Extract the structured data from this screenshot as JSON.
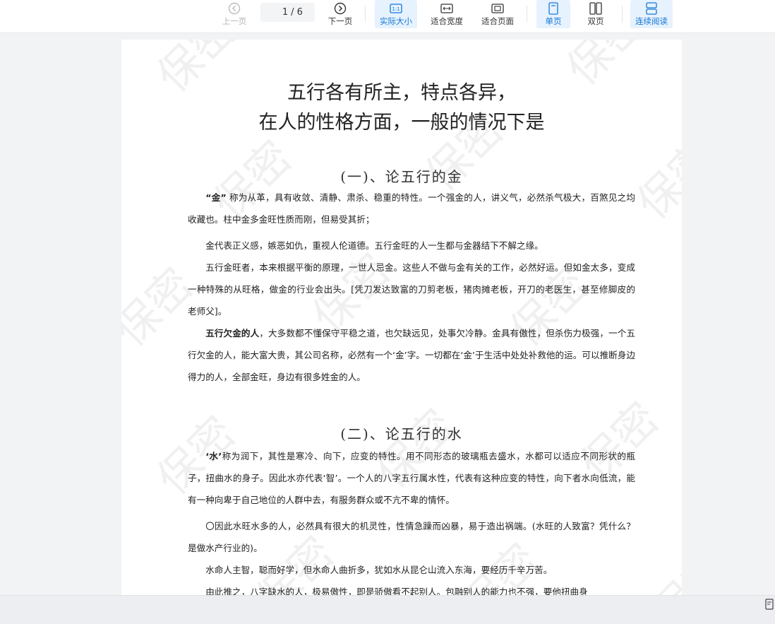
{
  "toolbar": {
    "prev_label": "上一页",
    "next_label": "下一页",
    "current_page": "1",
    "total_pages": "/ 6",
    "actual_size_label": "实际大小",
    "actual_size_icon_text": "1:1",
    "fit_width_label": "适合宽度",
    "fit_page_label": "适合页面",
    "single_page_label": "单页",
    "double_page_label": "双页",
    "continuous_label": "连续阅读"
  },
  "document": {
    "title_line1": "五行各有所主，特点各异，",
    "title_line2": "在人的性格方面，一般的情况下是",
    "watermark": "保密",
    "section1": {
      "heading": "(一)、论五行的金",
      "p1_bold": "“金”",
      "p1": " 称为从革，具有收敛、清静、肃杀、稳重的特性。一个强金的人，讲义气，必然杀气极大，百煞见之均收藏也。柱中金多金旺性质而刚，但易受其折；",
      "p2": "金代表正义感，嫉恶如仇，重视人伦道德。五行金旺的人一生都与金器结下不解之缘。",
      "p3": "五行金旺者，本来根据平衡的原理，一世人忌金。这些人不做与金有关的工作，必然好运。但如金太多，变成一种特殊的从旺格，做金的行业会出头。[凭刀发达致富的刀剪老板，猪肉摊老板，开刀的老医生，甚至修脚皮的老师父]。",
      "p4_bold": "五行欠金的人",
      "p4": "，大多数都不懂保守平稳之道，也欠缺远见，处事欠冷静。金具有傲性，但杀伤力极强，一个五行欠金的人，能大富大贵，其公司名称，必然有一个‘金’字。一切都在‘金’于生活中处处补救他的运。可以推断身边得力的人，全部金旺，身边有很多姓金的人。"
    },
    "section2": {
      "heading": "(二)、论五行的水",
      "p1_bold": "‘水’",
      "p1": "称为润下，其性是寒冷、向下，应变的特性。用不同形态的玻璃瓶去盛水，水都可以适应不同形状的瓶子，扭曲水的身子。因此水亦代表‘智’。一个人的八字五行属水性，代表有这种应变的特性，向下者水向低流，能有一种向卑于自己地位的人群中去，有服务群众或不亢不卑的情怀。",
      "p2": "〇因此水旺水多的人，必然具有很大的机灵性，性情急躁而凶暴，易于造出祸端。(水旺的人致富？凭什么？是做水产行业的)。",
      "p3": "水命人主智，聪而好学，但水命人曲折多，犹如水从昆仑山流入东海，要经历千辛万苦。",
      "p4": "由此推之，八字缺水的人，极易傲性，即是骄傲看不起别人。包融别人的能力也不强，要他扭曲身"
    }
  },
  "colors": {
    "accent": "#1677d8",
    "active_bg": "#e6f2fd",
    "viewer_bg": "#f2f3f5"
  }
}
